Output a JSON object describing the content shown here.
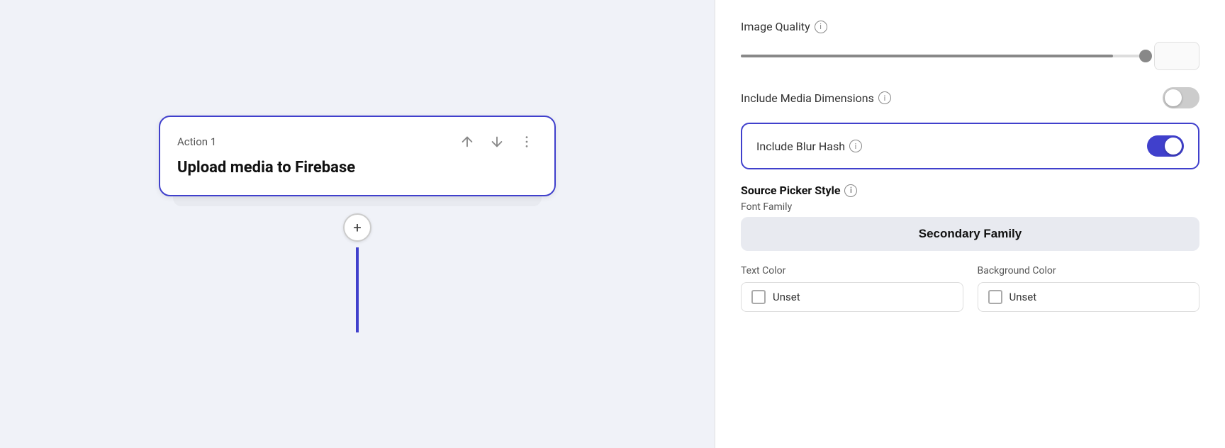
{
  "canvas": {
    "action_label": "Action 1",
    "card_title": "Upload media to Firebase",
    "add_button_label": "+"
  },
  "right_panel": {
    "image_quality_label": "Image Quality",
    "image_quality_value": "",
    "include_media_dimensions_label": "Include Media Dimensions",
    "include_media_dimensions_state": "off",
    "include_blur_hash_label": "Include Blur Hash",
    "include_blur_hash_state": "on",
    "source_picker_style_label": "Source Picker Style",
    "font_family_label": "Font Family",
    "font_family_value": "Secondary Family",
    "text_color_label": "Text Color",
    "text_color_value": "Unset",
    "background_color_label": "Background Color",
    "background_color_value": "Unset",
    "info_icon_label": "i"
  }
}
